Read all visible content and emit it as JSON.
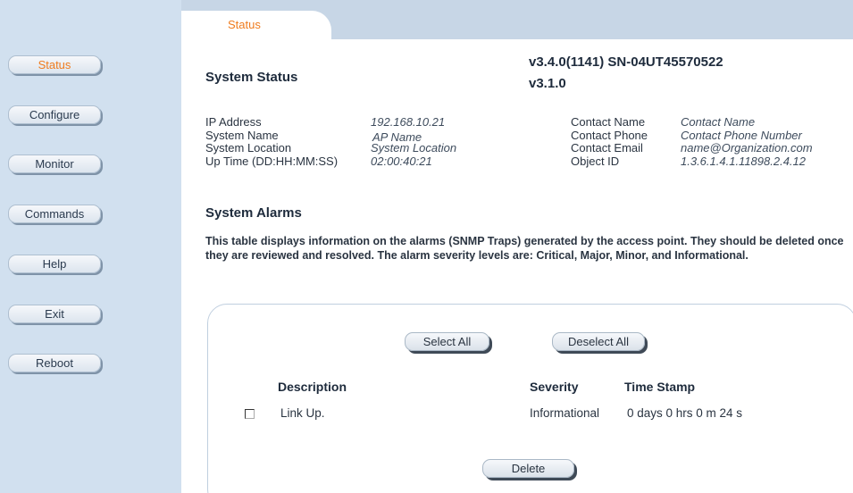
{
  "tab": {
    "label": "Status"
  },
  "nav": {
    "status": "Status",
    "configure": "Configure",
    "monitor": "Monitor",
    "commands": "Commands",
    "help": "Help",
    "exit": "Exit",
    "reboot": "Reboot"
  },
  "system_status": {
    "title": "System Status",
    "firmware_line1": "v3.4.0(1141) SN-04UT45570522",
    "firmware_line2": "v3.1.0",
    "fields": {
      "ip_label": "IP Address",
      "ip_value": "192.168.10.21",
      "name_label": "System Name",
      "name_value": "AP Name",
      "location_label": "System Location",
      "location_value": "System Location",
      "uptime_label": "Up Time (DD:HH:MM:SS)",
      "uptime_value": "02:00:40:21",
      "contact_name_label": "Contact Name",
      "contact_name_value": "Contact Name",
      "contact_phone_label": "Contact Phone",
      "contact_phone_value": "Contact Phone Number",
      "contact_email_label": "Contact Email",
      "contact_email_value": "name@Organization.com",
      "object_id_label": "Object ID",
      "object_id_value": "1.3.6.1.4.1.11898.2.4.12"
    }
  },
  "alarms": {
    "title": "System Alarms",
    "description": "This table displays information on the alarms (SNMP Traps) generated by the access point. They should be deleted once they are reviewed and resolved. The alarm severity levels are: Critical, Major, Minor, and Informational.",
    "select_all": "Select All",
    "deselect_all": "Deselect All",
    "delete": "Delete",
    "columns": {
      "description": "Description",
      "severity": "Severity",
      "timestamp": "Time Stamp"
    },
    "rows": [
      {
        "description": "Link Up.",
        "severity": "Informational",
        "timestamp": "0 days 0 hrs 0 m 24 s",
        "checked": false
      }
    ]
  }
}
